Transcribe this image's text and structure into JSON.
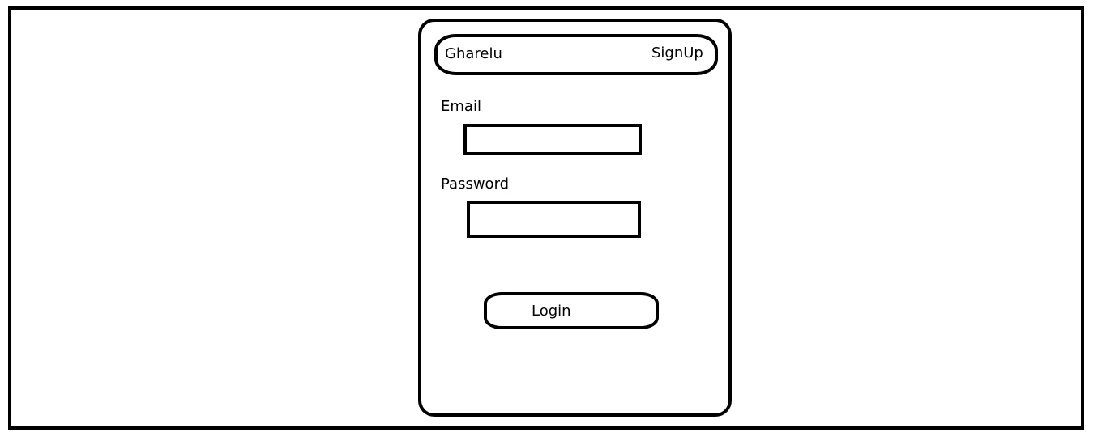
{
  "navbar": {
    "brand": "Gharelu",
    "signup_label": "SignUp"
  },
  "login_form": {
    "email_label": "Email",
    "email_value": "",
    "password_label": "Password",
    "password_value": "",
    "login_label": "Login"
  },
  "colors": {
    "stroke": "#000000",
    "background": "#ffffff"
  }
}
